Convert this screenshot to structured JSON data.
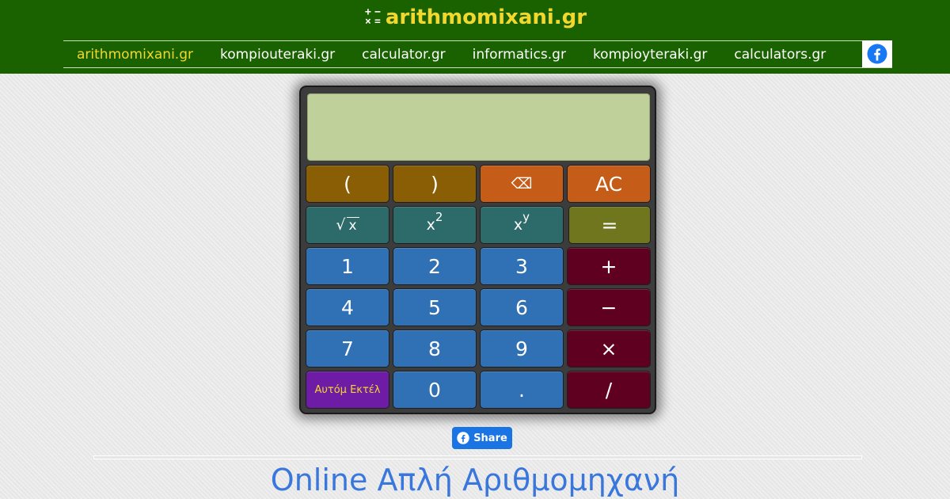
{
  "header": {
    "logo_symbols": [
      "+",
      "−",
      "×",
      "="
    ],
    "logo_text": "arithmomixani.gr",
    "nav": [
      {
        "label": "arithmomixani.gr",
        "active": true
      },
      {
        "label": "kompiouteraki.gr",
        "active": false
      },
      {
        "label": "calculator.gr",
        "active": false
      },
      {
        "label": "informatics.gr",
        "active": false
      },
      {
        "label": "kompioyteraki.gr",
        "active": false
      },
      {
        "label": "calculators.gr",
        "active": false
      }
    ],
    "facebook_icon": "facebook-icon"
  },
  "calculator": {
    "display_value": "",
    "buttons": {
      "lparen": "(",
      "rparen": ")",
      "backspace": "⌫",
      "clear": "AC",
      "sqrt_symbol": "√",
      "sqrt_var": "x",
      "square_base": "x",
      "square_exp": "2",
      "power_base": "x",
      "power_exp": "y",
      "equals": "=",
      "one": "1",
      "two": "2",
      "three": "3",
      "plus": "+",
      "four": "4",
      "five": "5",
      "six": "6",
      "minus": "−",
      "seven": "7",
      "eight": "8",
      "nine": "9",
      "times": "×",
      "auto_exec": "Αυτόμ Εκτέλ",
      "zero": "0",
      "dot": ".",
      "divide": "/"
    }
  },
  "share_label": "Share",
  "page_title": "Online Απλή Αριθμομηχανή",
  "colors": {
    "header_bg": "#1a6200",
    "accent_yellow": "#f2d82c",
    "digit_blue": "#3070b4",
    "operator_red": "#600020",
    "title_blue": "#3a77dd",
    "display_green": "#bfd09a"
  }
}
